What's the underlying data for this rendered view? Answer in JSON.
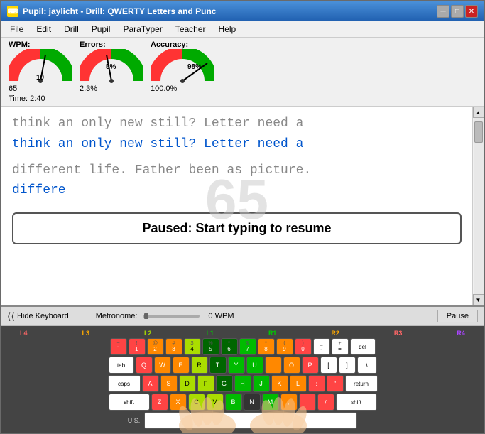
{
  "window": {
    "title": "Pupil: jaylicht  -  Drill: QWERTY Letters and Punc",
    "icon": "⌨"
  },
  "titleButtons": {
    "minimize": "─",
    "maximize": "□",
    "close": "✕"
  },
  "menu": {
    "items": [
      "File",
      "Edit",
      "Drill",
      "Pupil",
      "ParaTyper",
      "Teacher",
      "Help"
    ],
    "underlines": [
      0,
      0,
      0,
      0,
      0,
      0,
      0
    ]
  },
  "stats": {
    "wpm_label": "WPM:",
    "wpm_value": "65",
    "errors_label": "Errors:",
    "errors_value": "2.3%",
    "accuracy_label": "Accuracy:",
    "accuracy_value": "100.0%",
    "time_label": "Time:",
    "time_value": "2:40",
    "gauge1_needle": 10,
    "gauge2_needle": 5,
    "gauge3_needle": 98
  },
  "textContent": {
    "line1_gray": "think an only new still?  Letter need a",
    "line2_blue": "think an only new still?  Letter need a",
    "line3_gray": "different life.  Father been as picture.",
    "line4_blue": "differe",
    "watermark": "65"
  },
  "pauseMessage": "Paused: Start typing to resume",
  "keyboardControls": {
    "hide_keyboard": "Hide Keyboard",
    "metronome": "Metronome:",
    "wpm": "0 WPM",
    "pause": "Pause"
  },
  "keyboard": {
    "zoneLabels": [
      "L4",
      "L3",
      "L2",
      "L1",
      "R1",
      "R2",
      "R3",
      "R4"
    ],
    "row1": [
      "~`",
      "1!",
      "2@",
      "3#",
      "4$",
      "5%",
      "6^",
      "7&",
      "8*",
      "9(",
      "0)",
      "-_",
      "=+",
      "del"
    ],
    "row2": [
      "tab",
      "Q",
      "W",
      "E",
      "R",
      "T",
      "Y",
      "U",
      "I",
      "O",
      "P",
      "[{",
      "]}",
      "\\|"
    ],
    "row3": [
      "caps",
      "A",
      "S",
      "D",
      "F",
      "G",
      "H",
      "J",
      "K",
      "L",
      ";:",
      "'\"",
      "return"
    ],
    "row4": [
      "shift",
      "Z",
      "X",
      "C",
      "V",
      "B",
      "N",
      "M",
      ",<",
      ".>",
      "/?",
      "shift"
    ],
    "locale": "U.S."
  },
  "colors": {
    "red": "#ff3333",
    "orange": "#ff8800",
    "yellow_green": "#aadd00",
    "green": "#00aa00",
    "purple": "#9922ff",
    "blue_text": "#0055cc",
    "gray_text": "#888888"
  }
}
